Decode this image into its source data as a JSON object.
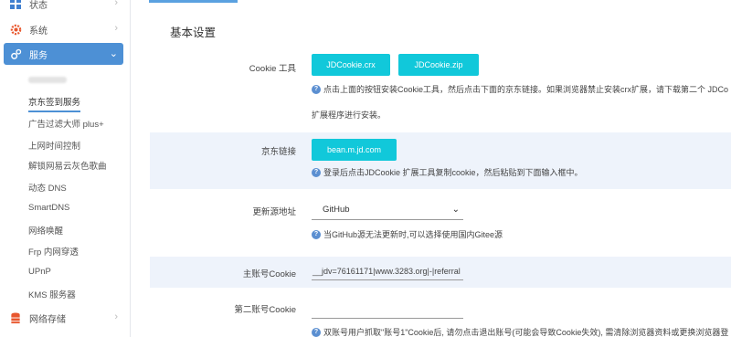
{
  "sidebar": {
    "items": [
      {
        "label": "状态"
      },
      {
        "label": "系统"
      },
      {
        "label": "服务"
      },
      {
        "label": "网络存储"
      }
    ],
    "sub_items": [
      "京东签到服务",
      "广告过滤大师 plus+",
      "上网时间控制",
      "解锁网易云灰色歌曲",
      "动态 DNS",
      "SmartDNS",
      "网络唤醒",
      "Frp 内网穿透",
      "UPnP",
      "KMS 服务器"
    ]
  },
  "main": {
    "section_title": "基本设置",
    "cookie_tool": {
      "label": "Cookie 工具",
      "btn_crx": "JDCookie.crx",
      "btn_zip": "JDCookie.zip",
      "hint1": "点击上面的按钮安装Cookie工具，然后点击下面的京东链接。如果浏览器禁止安装crx扩展，请下载第二个 JDCo",
      "hint2": "扩展程序进行安装。"
    },
    "jd_link": {
      "label": "京东链接",
      "btn": "bean.m.jd.com",
      "hint": "登录后点击JDCookie 扩展工具复制cookie，然后粘贴到下面输入框中。"
    },
    "update_source": {
      "label": "更新源地址",
      "value": "GitHub",
      "hint": "当GitHub源无法更新时,可以选择使用国内Gitee源"
    },
    "main_account": {
      "label": "主账号Cookie",
      "value": "__jdv=76161171|www.3283.org|-|referral"
    },
    "second_account": {
      "label": "第二账号Cookie",
      "value": "",
      "hint": "双账号用户抓取\"账号1\"Cookie后, 请勿点击退出账号(可能会导致Cookie失效), 需清除浏览器资料或更换浏览器登"
    }
  }
}
